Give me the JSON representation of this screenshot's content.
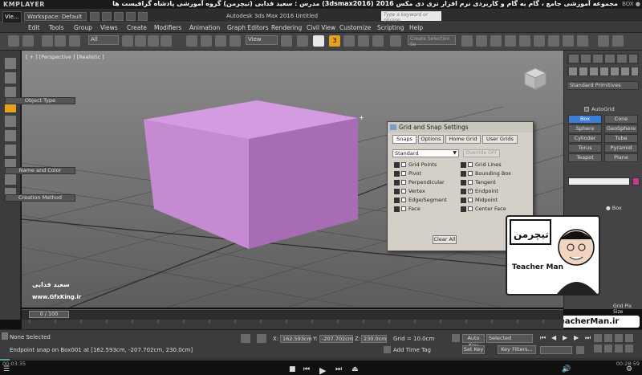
{
  "player": {
    "logo": "KMPLAYER",
    "banner": "مجموعه آموزشی جامع ، گام به گام و کاربردی نرم افزار تری دی مکس 2016  (3dsmax2016)  مدرس : سعید فدایی (تیچرمن) گروه آموزشی پادشاه گرافیست ها",
    "box_label": "BOX ●",
    "time_elapsed": "00:03:35",
    "time_total": "00:28:59"
  },
  "titlebar": {
    "app_badge": "Vie...",
    "workspace": "Workspace: Default",
    "app_title": "Autodesk 3ds Max 2016     Untitled",
    "search_placeholder": "Type a keyword or phrase"
  },
  "menu": [
    "Edit",
    "Tools",
    "Group",
    "Views",
    "Create",
    "Modifiers",
    "Animation",
    "Graph Editors",
    "Rendering",
    "Civil View",
    "Customize",
    "Scripting",
    "Help"
  ],
  "toolbar": {
    "filter": "All",
    "view": "View",
    "selection_set": "Create Selection Se"
  },
  "viewport": {
    "label": "[ + ] [Perspective ] [Realistic ]",
    "object_color": "#c68ad3"
  },
  "command_panel": {
    "category": "Standard Primitives",
    "object_type_header": "Object Type",
    "autogrid": "AutoGrid",
    "buttons": [
      "Box",
      "Cone",
      "Sphere",
      "GeoSphere",
      "Cylinder",
      "Tube",
      "Torus",
      "Pyramid",
      "Teapot",
      "Plane"
    ],
    "name_color_header": "Name and Color",
    "creation_method_header": "Creation Method",
    "creation_option": "Box",
    "cube_label": "Cube"
  },
  "dialog": {
    "title": "Grid and Snap Settings",
    "tabs": [
      "Snaps",
      "Options",
      "Home Grid",
      "User Grids"
    ],
    "preset": "Standard",
    "override": "Override OFF",
    "snaps_left": [
      {
        "label": "Grid Points",
        "checked": false
      },
      {
        "label": "Pivot",
        "checked": false
      },
      {
        "label": "Perpendicular",
        "checked": false
      },
      {
        "label": "Vertex",
        "checked": false
      },
      {
        "label": "Edge/Segment",
        "checked": false
      },
      {
        "label": "Face",
        "checked": false
      }
    ],
    "snaps_right": [
      {
        "label": "Grid Lines",
        "checked": false
      },
      {
        "label": "Bounding Box",
        "checked": false
      },
      {
        "label": "Tangent",
        "checked": false
      },
      {
        "label": "Endpoint",
        "checked": true
      },
      {
        "label": "Midpoint",
        "checked": false
      },
      {
        "label": "Center Face",
        "checked": false
      }
    ],
    "clear_all": "Clear All"
  },
  "timeline": {
    "frame": "0 / 100"
  },
  "status": {
    "selection": "None Selected",
    "prompt": "Endpoint snap on Box001 at [162.593cm, -207.702cm, 230.0cm]",
    "x_label": "X:",
    "x_value": "162.593cm",
    "y_label": "Y:",
    "y_value": "-207.702cm",
    "z_label": "Z:",
    "z_value": "230.0cm",
    "grid": "Grid = 10.0cm",
    "add_time_tag": "Add Time Tag",
    "auto_key": "Auto Key",
    "set_key": "Set Key",
    "key_mode": "Selected",
    "key_filters": "Key Filters..."
  },
  "watermark": {
    "name": "سعید فدایی",
    "site": "www.GfxKing.ir",
    "teacher_title": "Teacher Man",
    "teacher_url": "www.TeacherMan.ir",
    "grid_spacing_hint": "Grid Pix Size"
  }
}
